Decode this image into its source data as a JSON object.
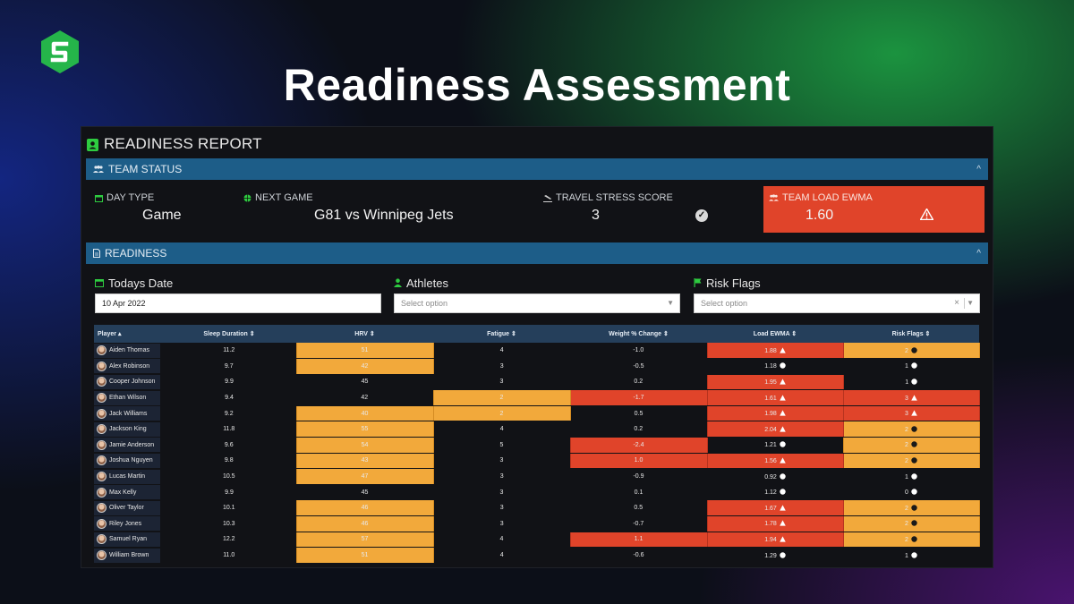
{
  "hero_title": "Readiness Assessment",
  "report_title": "READINESS REPORT",
  "team_status": {
    "label": "TEAM STATUS",
    "day_type": {
      "label": "DAY TYPE",
      "value": "Game"
    },
    "next_game": {
      "label": "NEXT GAME",
      "value": "G81 vs Winnipeg Jets"
    },
    "travel_stress": {
      "label": "TRAVEL STRESS SCORE",
      "value": "3"
    },
    "team_load": {
      "label": "TEAM LOAD EWMA",
      "value": "1.60"
    }
  },
  "readiness": {
    "label": "READINESS",
    "filters": {
      "date": {
        "label": "Todays Date",
        "value": "10 Apr 2022"
      },
      "athletes": {
        "label": "Athletes",
        "placeholder": "Select option"
      },
      "risk_flags": {
        "label": "Risk Flags",
        "placeholder": "Select option"
      }
    }
  },
  "table": {
    "columns": [
      "Player ▴",
      "Sleep Duration ⇕",
      "HRV ⇕",
      "Fatigue ⇕",
      "Weight % Change ⇕",
      "Load EWMA ⇕",
      "Risk Flags ⇕"
    ],
    "rows": [
      {
        "player": "Aiden Thomas",
        "sleep": "11.2",
        "hrv": "51",
        "fatigue": "4",
        "weight": "-1.0",
        "load": "1.88",
        "flags": "2"
      },
      {
        "player": "Alex Robinson",
        "sleep": "9.7",
        "hrv": "42",
        "fatigue": "3",
        "weight": "-0.5",
        "load": "1.18",
        "flags": "1"
      },
      {
        "player": "Cooper Johnson",
        "sleep": "9.9",
        "hrv": "45",
        "fatigue": "3",
        "weight": "0.2",
        "load": "1.95",
        "flags": "1"
      },
      {
        "player": "Ethan Wilson",
        "sleep": "9.4",
        "hrv": "42",
        "fatigue": "2",
        "weight": "-1.7",
        "load": "1.61",
        "flags": "3"
      },
      {
        "player": "Jack Williams",
        "sleep": "9.2",
        "hrv": "40",
        "fatigue": "2",
        "weight": "0.5",
        "load": "1.98",
        "flags": "3"
      },
      {
        "player": "Jackson King",
        "sleep": "11.8",
        "hrv": "55",
        "fatigue": "4",
        "weight": "0.2",
        "load": "2.04",
        "flags": "2"
      },
      {
        "player": "Jamie Anderson",
        "sleep": "9.6",
        "hrv": "54",
        "fatigue": "5",
        "weight": "-2.4",
        "load": "1.21",
        "flags": "2"
      },
      {
        "player": "Joshua Nguyen",
        "sleep": "9.8",
        "hrv": "43",
        "fatigue": "3",
        "weight": "1.0",
        "load": "1.56",
        "flags": "2"
      },
      {
        "player": "Lucas Martin",
        "sleep": "10.5",
        "hrv": "47",
        "fatigue": "3",
        "weight": "-0.9",
        "load": "0.92",
        "flags": "1"
      },
      {
        "player": "Max Kelly",
        "sleep": "9.9",
        "hrv": "45",
        "fatigue": "3",
        "weight": "0.1",
        "load": "1.12",
        "flags": "0"
      },
      {
        "player": "Oliver Taylor",
        "sleep": "10.1",
        "hrv": "46",
        "fatigue": "3",
        "weight": "0.5",
        "load": "1.67",
        "flags": "2"
      },
      {
        "player": "Riley Jones",
        "sleep": "10.3",
        "hrv": "46",
        "fatigue": "3",
        "weight": "-0.7",
        "load": "1.78",
        "flags": "2"
      },
      {
        "player": "Samuel Ryan",
        "sleep": "12.2",
        "hrv": "57",
        "fatigue": "4",
        "weight": "1.1",
        "load": "1.94",
        "flags": "2"
      },
      {
        "player": "William Brown",
        "sleep": "11.0",
        "hrv": "51",
        "fatigue": "4",
        "weight": "-0.6",
        "load": "1.29",
        "flags": "1"
      }
    ],
    "highlights": [
      {
        "hrv": "orange",
        "load": "red",
        "flags": "orange"
      },
      {
        "hrv": "orange"
      },
      {
        "load": "red"
      },
      {
        "fatigue": "orange",
        "weight": "red",
        "load": "red",
        "flags": "red"
      },
      {
        "hrv": "orange",
        "fatigue": "orange",
        "load": "red",
        "flags": "red"
      },
      {
        "hrv": "orange",
        "load": "red",
        "flags": "orange"
      },
      {
        "hrv": "orange",
        "weight": "red",
        "flags": "orange"
      },
      {
        "hrv": "orange",
        "weight": "red",
        "load": "red",
        "flags": "orange"
      },
      {
        "hrv": "orange"
      },
      {},
      {
        "hrv": "orange",
        "load": "red",
        "flags": "orange"
      },
      {
        "hrv": "orange",
        "load": "red",
        "flags": "orange"
      },
      {
        "hrv": "orange",
        "weight": "red",
        "load": "red",
        "flags": "orange"
      },
      {
        "hrv": "orange"
      }
    ],
    "load_icons": [
      "warning-icon",
      "check-icon",
      "warning-icon",
      "warning-icon",
      "warning-icon",
      "warning-icon",
      "check-icon",
      "warning-icon",
      "check-icon",
      "check-icon",
      "warning-icon",
      "warning-icon",
      "warning-icon",
      "check-icon"
    ],
    "flag_icons": [
      "info-icon",
      "check-icon",
      "check-icon",
      "warning-icon",
      "warning-icon",
      "info-icon",
      "info-icon",
      "info-icon",
      "check-icon",
      "info-icon",
      "info-icon",
      "info-icon",
      "info-icon",
      "check-icon"
    ]
  },
  "colors": {
    "orange": "#f2a93b",
    "red": "#e0442a",
    "section_bar": "#1d5d88",
    "header": "#253f5b",
    "accent_green": "#2ecc40"
  }
}
